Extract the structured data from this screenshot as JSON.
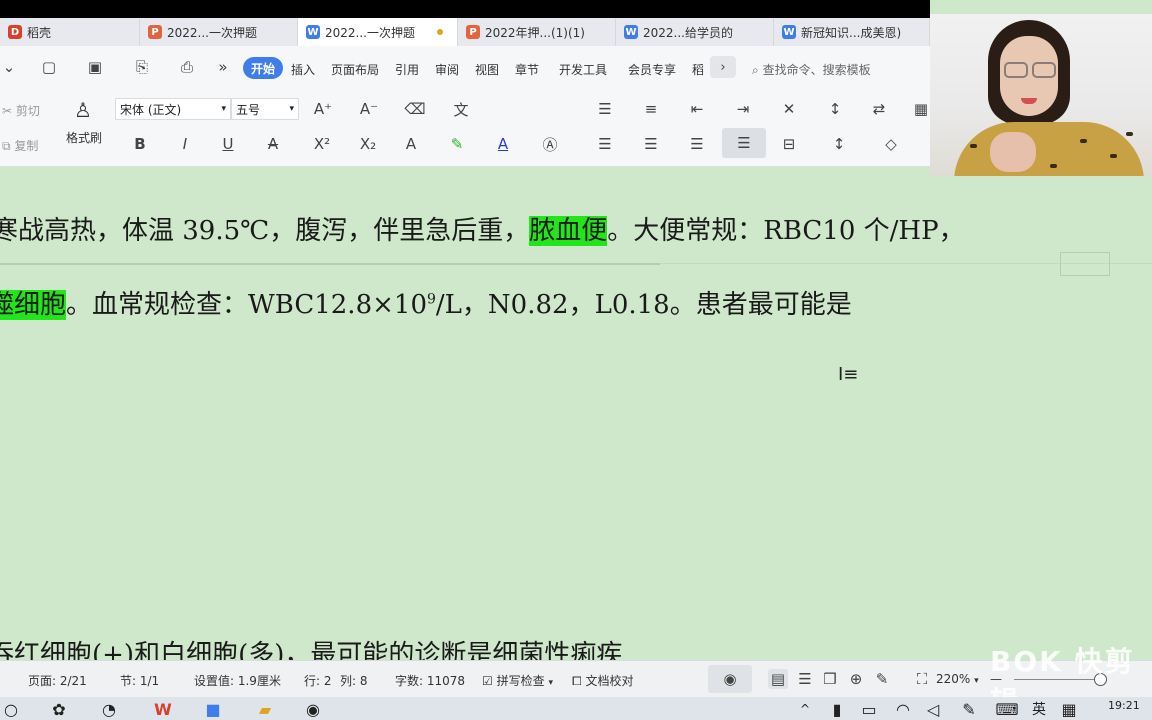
{
  "tabs": [
    {
      "label": "稻壳",
      "icon": "daoke-icon"
    },
    {
      "label": "2022...一次押题",
      "icon": "ppt-icon"
    },
    {
      "label": "2022...一次押题",
      "icon": "wps-writer-icon",
      "active": true
    },
    {
      "label": "2022年押...(1)(1)",
      "icon": "ppt-icon"
    },
    {
      "label": "2022...给学员的",
      "icon": "wps-writer-icon"
    },
    {
      "label": "新冠知识...成美恩)",
      "icon": "wps-writer-icon"
    }
  ],
  "menu": {
    "items": [
      "开始",
      "插入",
      "页面布局",
      "引用",
      "审阅",
      "视图",
      "章节",
      "开发工具",
      "会员专享",
      "稻"
    ],
    "search_placeholder": "查找命令、搜索模板"
  },
  "ribbon": {
    "cut": "剪切",
    "copy": "复制",
    "format_painter": "格式刷",
    "font_name": "宋体 (正文)",
    "font_size": "五号"
  },
  "document": {
    "line1_a": "寒战高热，体温 39.5℃，腹泻，伴里急后重，",
    "line1_hl": "脓血便",
    "line1_b": "。大便常规：RBC10 个/HP，",
    "line2_hl": "噬细胞",
    "line2_a": "。血常规检查：WBC12.8×10",
    "line2_sup": "9",
    "line2_b": "/L，N0.82，L0.18。患者最可能是",
    "line3": "吞红细胞(+)和白细胞(多)，最可能的诊断是细菌性痢疾"
  },
  "status": {
    "page": "页面: 2/21",
    "section": "节: 1/1",
    "setting": "设置值: 1.9厘米",
    "row": "行: 2",
    "col": "列: 8",
    "words": "字数: 11078",
    "spellcheck": "拼写检查",
    "proofread": "文档校对",
    "zoom": "220%"
  },
  "taskbar": {
    "ime": "英",
    "time": "19:21"
  },
  "watermark": "快剪辑",
  "colors": {
    "highlight": "#22e51a",
    "doc_bg": "#cfe8cb",
    "accent": "#3f7ee8"
  }
}
